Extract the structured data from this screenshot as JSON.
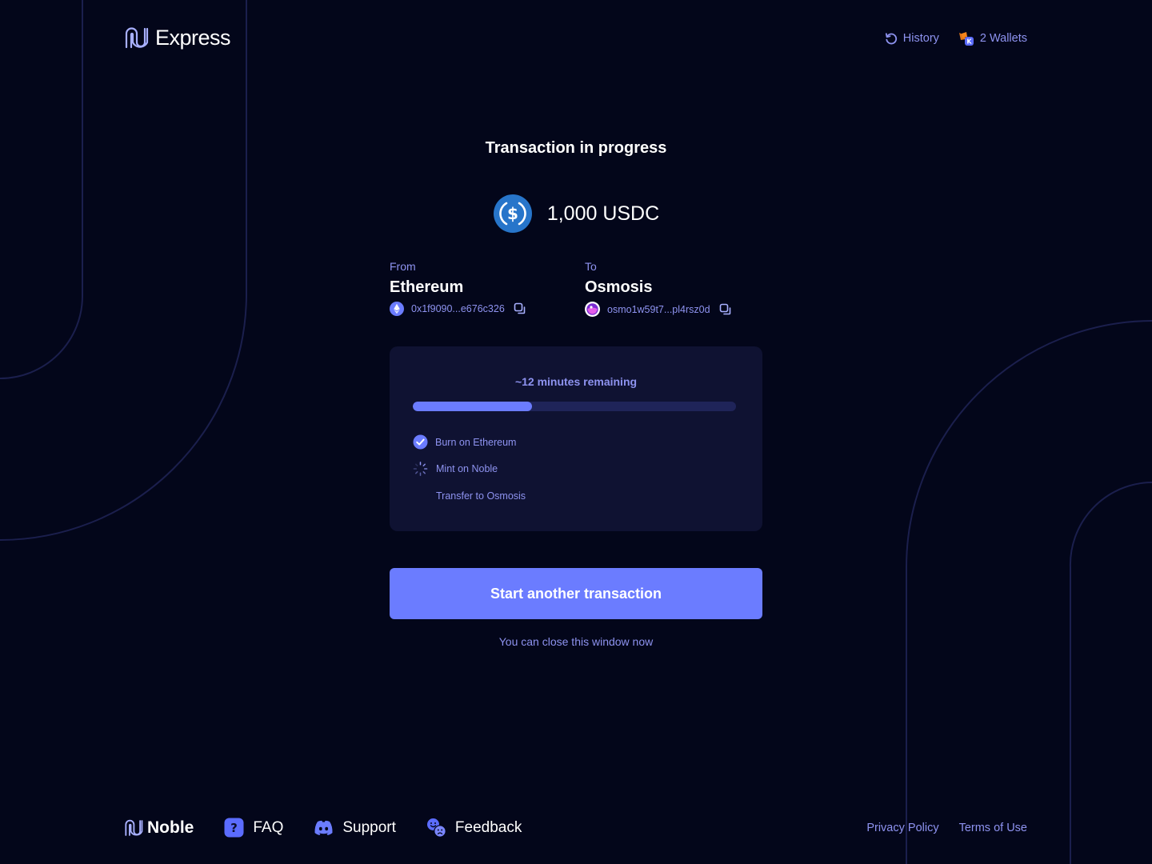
{
  "header": {
    "brand": "Express",
    "nav": {
      "history_label": "History",
      "wallets_label": "2 Wallets"
    }
  },
  "transaction": {
    "title": "Transaction in progress",
    "amount": "1,000 USDC",
    "token_icon": "usdc-icon",
    "from": {
      "label": "From",
      "chain": "Ethereum",
      "address": "0x1f9090...e676c326",
      "icon": "ethereum-icon"
    },
    "to": {
      "label": "To",
      "chain": "Osmosis",
      "address": "osmo1w59t7...pl4rsz0d",
      "icon": "osmosis-icon"
    }
  },
  "progress": {
    "remaining_text": "~12 minutes remaining",
    "fraction": 0.37,
    "steps": [
      {
        "label": "Burn on Ethereum",
        "status": "complete"
      },
      {
        "label": "Mint on Noble",
        "status": "in-progress"
      },
      {
        "label": "Transfer to Osmosis",
        "status": "pending"
      }
    ]
  },
  "actions": {
    "primary_label": "Start another transaction",
    "note": "You can close this window now"
  },
  "footer": {
    "brand": "Noble",
    "links": {
      "faq": "FAQ",
      "support": "Support",
      "feedback": "Feedback"
    },
    "legal": {
      "privacy": "Privacy Policy",
      "terms": "Terms of Use"
    }
  },
  "colors": {
    "background": "#03061a",
    "card": "#0f1232",
    "accent": "#6b7cff",
    "muted_text": "#8e93f0",
    "track": "#1f2459",
    "usdc": "#2775ca"
  }
}
